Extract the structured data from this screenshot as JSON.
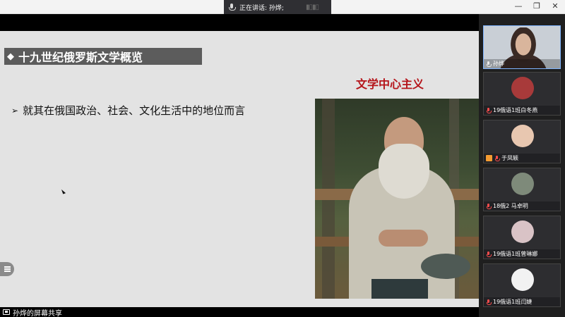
{
  "window": {
    "speaking_label": "正在讲话: 孙烨;",
    "controls": {
      "minimize": "—",
      "restore": "❐",
      "close": "✕"
    }
  },
  "slide": {
    "title": "十九世纪俄罗斯文学概览",
    "title_marker": "◆",
    "subtitle": "文学中心主义",
    "bullet_marker": "➢",
    "bullet_text": "就其在俄国政治、社会、文化生活中的地位而言"
  },
  "footer": {
    "share_label": "孙烨的屏幕共享"
  },
  "participants": [
    {
      "name": "孙烨",
      "active": true,
      "muted": false,
      "avatar": "camera-video"
    },
    {
      "name": "19俄语1班白冬燕",
      "active": false,
      "muted": true,
      "avatar": "#a83a3a"
    },
    {
      "name": "于凤颖",
      "active": false,
      "muted": true,
      "avatar": "#e8c7b0",
      "badge": true
    },
    {
      "name": "18俄2 马卓明",
      "active": false,
      "muted": true,
      "avatar": "#7e8a7a"
    },
    {
      "name": "19俄语1班曾琳娜",
      "active": false,
      "muted": true,
      "avatar": "#d9c3c6"
    },
    {
      "name": "19俄语1班闫婕",
      "active": false,
      "muted": true,
      "avatar": "#f2f2f2"
    }
  ]
}
